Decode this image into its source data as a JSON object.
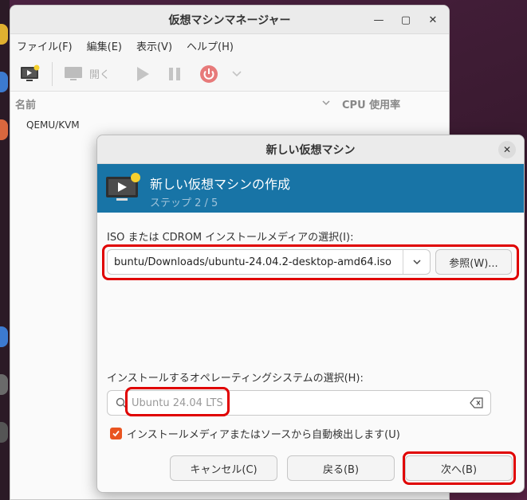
{
  "main_window": {
    "title": "仮想マシンマネージャー",
    "menu": [
      "ファイル(F)",
      "編集(E)",
      "表示(V)",
      "ヘルプ(H)"
    ],
    "toolbar": {
      "open_label": "開く"
    },
    "columns": {
      "name": "名前",
      "cpu": "CPU 使用率"
    },
    "connections": [
      "QEMU/KVM"
    ]
  },
  "dialog": {
    "title": "新しい仮想マシン",
    "banner_title": "新しい仮想マシンの作成",
    "banner_step": "ステップ 2 / 5",
    "iso_label": "ISO または CDROM インストールメディアの選択(I):",
    "iso_path": "buntu/Downloads/ubuntu-24.04.2-desktop-amd64.iso",
    "browse_label": "参照(W)...",
    "os_label": "インストールするオペレーティングシステムの選択(H):",
    "os_value": "Ubuntu 24.04 LTS",
    "autodetect_label": "インストールメディアまたはソースから自動検出します(U)",
    "autodetect_checked": true,
    "cancel_label": "キャンセル(C)",
    "back_label": "戻る(B)",
    "next_label": "次へ(B)"
  },
  "colors": {
    "banner": "#1874a6",
    "highlight": "#e00000",
    "accent": "#e95420"
  }
}
